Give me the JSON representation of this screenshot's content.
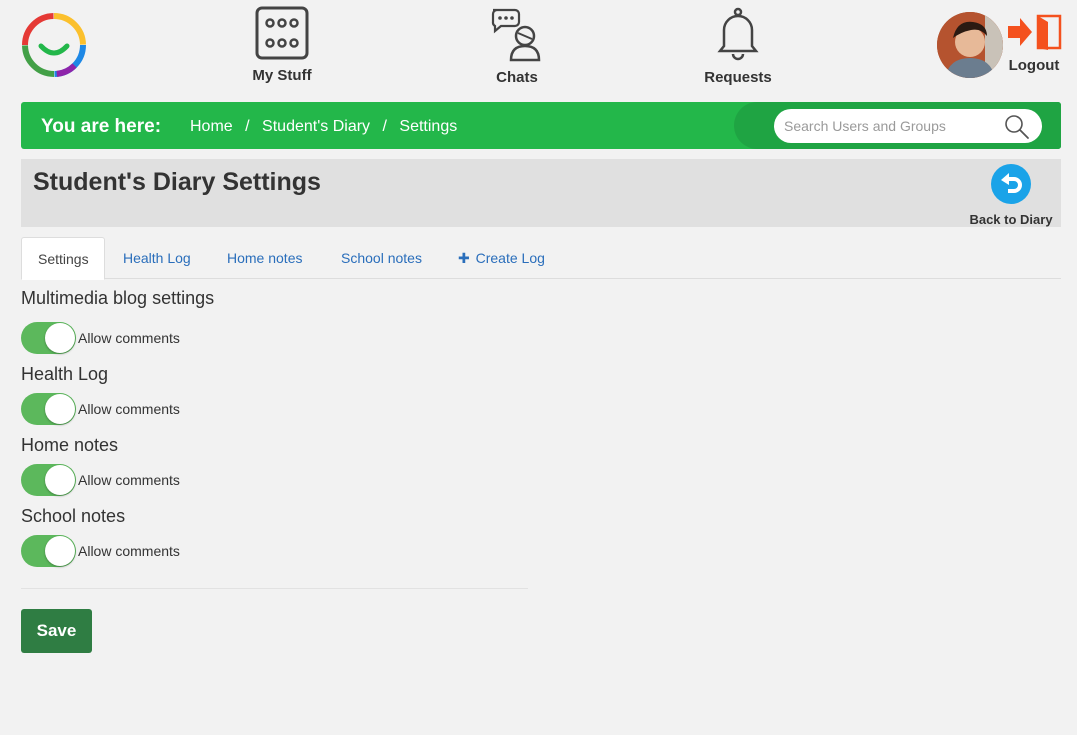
{
  "nav": {
    "my_stuff": "My Stuff",
    "chats": "Chats",
    "requests": "Requests",
    "logout": "Logout"
  },
  "breadcrumb": {
    "title": "You are here:",
    "items": [
      "Home",
      "Student's Diary",
      "Settings"
    ],
    "separator": "/"
  },
  "search": {
    "placeholder": "Search Users and Groups",
    "value": ""
  },
  "page": {
    "title": "Student's Diary Settings",
    "back_label": "Back to Diary"
  },
  "tabs": [
    {
      "label": "Settings",
      "active": true
    },
    {
      "label": "Health Log"
    },
    {
      "label": "Home notes"
    },
    {
      "label": "School notes"
    },
    {
      "label": "Create Log",
      "icon": "plus-icon"
    }
  ],
  "sections": [
    {
      "title": "Multimedia blog settings",
      "toggle_label": "Allow comments",
      "enabled": true
    },
    {
      "title": "Health Log",
      "toggle_label": "Allow comments",
      "enabled": true
    },
    {
      "title": "Home notes",
      "toggle_label": "Allow comments",
      "enabled": true
    },
    {
      "title": "School notes",
      "toggle_label": "Allow comments",
      "enabled": true
    }
  ],
  "save_label": "Save",
  "colors": {
    "brand_green": "#23b74a",
    "toggle_on": "#5cb85c",
    "save_button": "#2f7d43",
    "link": "#2a6ebb",
    "logout_accent": "#f4511e",
    "back_icon": "#1aa3e8"
  }
}
